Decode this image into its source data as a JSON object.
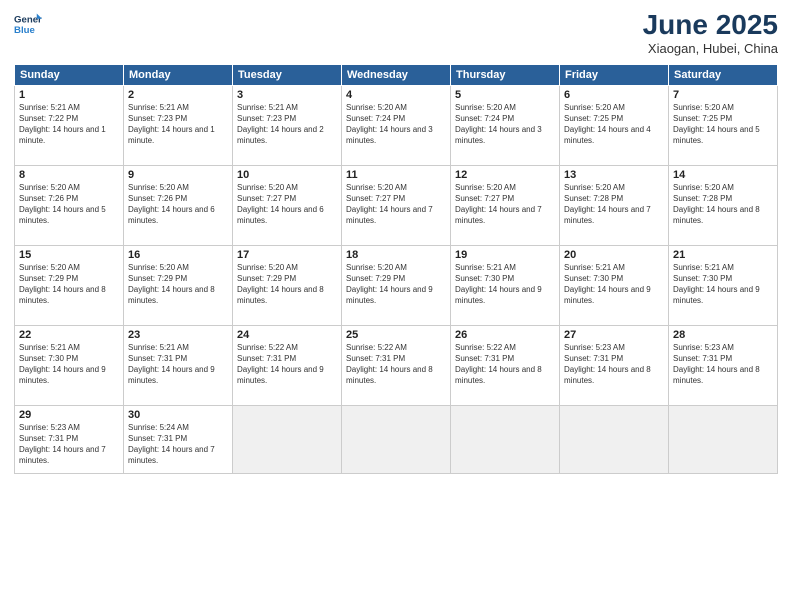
{
  "logo": {
    "line1": "General",
    "line2": "Blue"
  },
  "title": "June 2025",
  "subtitle": "Xiaogan, Hubei, China",
  "days_header": [
    "Sunday",
    "Monday",
    "Tuesday",
    "Wednesday",
    "Thursday",
    "Friday",
    "Saturday"
  ],
  "weeks": [
    [
      {
        "day": "1",
        "sunrise": "Sunrise: 5:21 AM",
        "sunset": "Sunset: 7:22 PM",
        "daylight": "Daylight: 14 hours and 1 minute."
      },
      {
        "day": "2",
        "sunrise": "Sunrise: 5:21 AM",
        "sunset": "Sunset: 7:23 PM",
        "daylight": "Daylight: 14 hours and 1 minute."
      },
      {
        "day": "3",
        "sunrise": "Sunrise: 5:21 AM",
        "sunset": "Sunset: 7:23 PM",
        "daylight": "Daylight: 14 hours and 2 minutes."
      },
      {
        "day": "4",
        "sunrise": "Sunrise: 5:20 AM",
        "sunset": "Sunset: 7:24 PM",
        "daylight": "Daylight: 14 hours and 3 minutes."
      },
      {
        "day": "5",
        "sunrise": "Sunrise: 5:20 AM",
        "sunset": "Sunset: 7:24 PM",
        "daylight": "Daylight: 14 hours and 3 minutes."
      },
      {
        "day": "6",
        "sunrise": "Sunrise: 5:20 AM",
        "sunset": "Sunset: 7:25 PM",
        "daylight": "Daylight: 14 hours and 4 minutes."
      },
      {
        "day": "7",
        "sunrise": "Sunrise: 5:20 AM",
        "sunset": "Sunset: 7:25 PM",
        "daylight": "Daylight: 14 hours and 5 minutes."
      }
    ],
    [
      {
        "day": "8",
        "sunrise": "Sunrise: 5:20 AM",
        "sunset": "Sunset: 7:26 PM",
        "daylight": "Daylight: 14 hours and 5 minutes."
      },
      {
        "day": "9",
        "sunrise": "Sunrise: 5:20 AM",
        "sunset": "Sunset: 7:26 PM",
        "daylight": "Daylight: 14 hours and 6 minutes."
      },
      {
        "day": "10",
        "sunrise": "Sunrise: 5:20 AM",
        "sunset": "Sunset: 7:27 PM",
        "daylight": "Daylight: 14 hours and 6 minutes."
      },
      {
        "day": "11",
        "sunrise": "Sunrise: 5:20 AM",
        "sunset": "Sunset: 7:27 PM",
        "daylight": "Daylight: 14 hours and 7 minutes."
      },
      {
        "day": "12",
        "sunrise": "Sunrise: 5:20 AM",
        "sunset": "Sunset: 7:27 PM",
        "daylight": "Daylight: 14 hours and 7 minutes."
      },
      {
        "day": "13",
        "sunrise": "Sunrise: 5:20 AM",
        "sunset": "Sunset: 7:28 PM",
        "daylight": "Daylight: 14 hours and 7 minutes."
      },
      {
        "day": "14",
        "sunrise": "Sunrise: 5:20 AM",
        "sunset": "Sunset: 7:28 PM",
        "daylight": "Daylight: 14 hours and 8 minutes."
      }
    ],
    [
      {
        "day": "15",
        "sunrise": "Sunrise: 5:20 AM",
        "sunset": "Sunset: 7:29 PM",
        "daylight": "Daylight: 14 hours and 8 minutes."
      },
      {
        "day": "16",
        "sunrise": "Sunrise: 5:20 AM",
        "sunset": "Sunset: 7:29 PM",
        "daylight": "Daylight: 14 hours and 8 minutes."
      },
      {
        "day": "17",
        "sunrise": "Sunrise: 5:20 AM",
        "sunset": "Sunset: 7:29 PM",
        "daylight": "Daylight: 14 hours and 8 minutes."
      },
      {
        "day": "18",
        "sunrise": "Sunrise: 5:20 AM",
        "sunset": "Sunset: 7:29 PM",
        "daylight": "Daylight: 14 hours and 9 minutes."
      },
      {
        "day": "19",
        "sunrise": "Sunrise: 5:21 AM",
        "sunset": "Sunset: 7:30 PM",
        "daylight": "Daylight: 14 hours and 9 minutes."
      },
      {
        "day": "20",
        "sunrise": "Sunrise: 5:21 AM",
        "sunset": "Sunset: 7:30 PM",
        "daylight": "Daylight: 14 hours and 9 minutes."
      },
      {
        "day": "21",
        "sunrise": "Sunrise: 5:21 AM",
        "sunset": "Sunset: 7:30 PM",
        "daylight": "Daylight: 14 hours and 9 minutes."
      }
    ],
    [
      {
        "day": "22",
        "sunrise": "Sunrise: 5:21 AM",
        "sunset": "Sunset: 7:30 PM",
        "daylight": "Daylight: 14 hours and 9 minutes."
      },
      {
        "day": "23",
        "sunrise": "Sunrise: 5:21 AM",
        "sunset": "Sunset: 7:31 PM",
        "daylight": "Daylight: 14 hours and 9 minutes."
      },
      {
        "day": "24",
        "sunrise": "Sunrise: 5:22 AM",
        "sunset": "Sunset: 7:31 PM",
        "daylight": "Daylight: 14 hours and 9 minutes."
      },
      {
        "day": "25",
        "sunrise": "Sunrise: 5:22 AM",
        "sunset": "Sunset: 7:31 PM",
        "daylight": "Daylight: 14 hours and 8 minutes."
      },
      {
        "day": "26",
        "sunrise": "Sunrise: 5:22 AM",
        "sunset": "Sunset: 7:31 PM",
        "daylight": "Daylight: 14 hours and 8 minutes."
      },
      {
        "day": "27",
        "sunrise": "Sunrise: 5:23 AM",
        "sunset": "Sunset: 7:31 PM",
        "daylight": "Daylight: 14 hours and 8 minutes."
      },
      {
        "day": "28",
        "sunrise": "Sunrise: 5:23 AM",
        "sunset": "Sunset: 7:31 PM",
        "daylight": "Daylight: 14 hours and 8 minutes."
      }
    ],
    [
      {
        "day": "29",
        "sunrise": "Sunrise: 5:23 AM",
        "sunset": "Sunset: 7:31 PM",
        "daylight": "Daylight: 14 hours and 7 minutes."
      },
      {
        "day": "30",
        "sunrise": "Sunrise: 5:24 AM",
        "sunset": "Sunset: 7:31 PM",
        "daylight": "Daylight: 14 hours and 7 minutes."
      },
      null,
      null,
      null,
      null,
      null
    ]
  ]
}
